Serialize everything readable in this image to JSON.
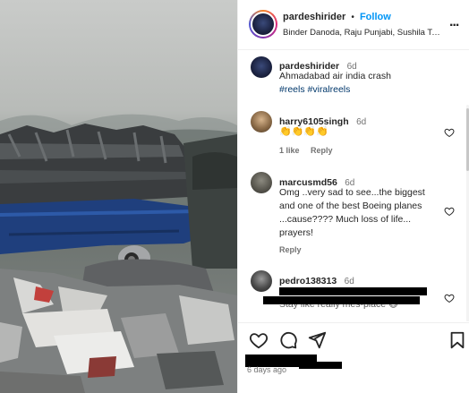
{
  "post": {
    "username": "pardeshirider",
    "dot": "•",
    "follow_label": "Follow",
    "audio_text": "Binder Danoda, Raju Punjabi, Sushila Tak...",
    "more_label": "..."
  },
  "comments": [
    {
      "username": "pardeshirider",
      "time": "6d",
      "text": "Ahmadabad air india crash",
      "hashtags": "#reels #viralreels"
    },
    {
      "username": "harry6105singh",
      "time": "6d",
      "text": "👏👏👏👏",
      "likes": "1 like",
      "reply_label": "Reply"
    },
    {
      "username": "marcusmd56",
      "time": "6d",
      "text_lines": [
        "Omg ..very sad to see...the biggest",
        "and one of the best Boeing planes",
        "...cause???? Much loss of life...",
        "prayers!"
      ],
      "reply_label": "Reply"
    },
    {
      "username": "pedro138313",
      "time": "6d",
      "partial_text": "Stay like really mes-place 😄"
    }
  ],
  "footer": {
    "time_ago": "6 days ago"
  },
  "icons": {
    "like": "heart-icon",
    "comment": "comment-icon",
    "share": "share-icon",
    "save": "bookmark-icon",
    "more": "more-icon"
  },
  "colors": {
    "follow": "#0095f6",
    "hashtag": "#00376b",
    "muted": "#737373"
  }
}
